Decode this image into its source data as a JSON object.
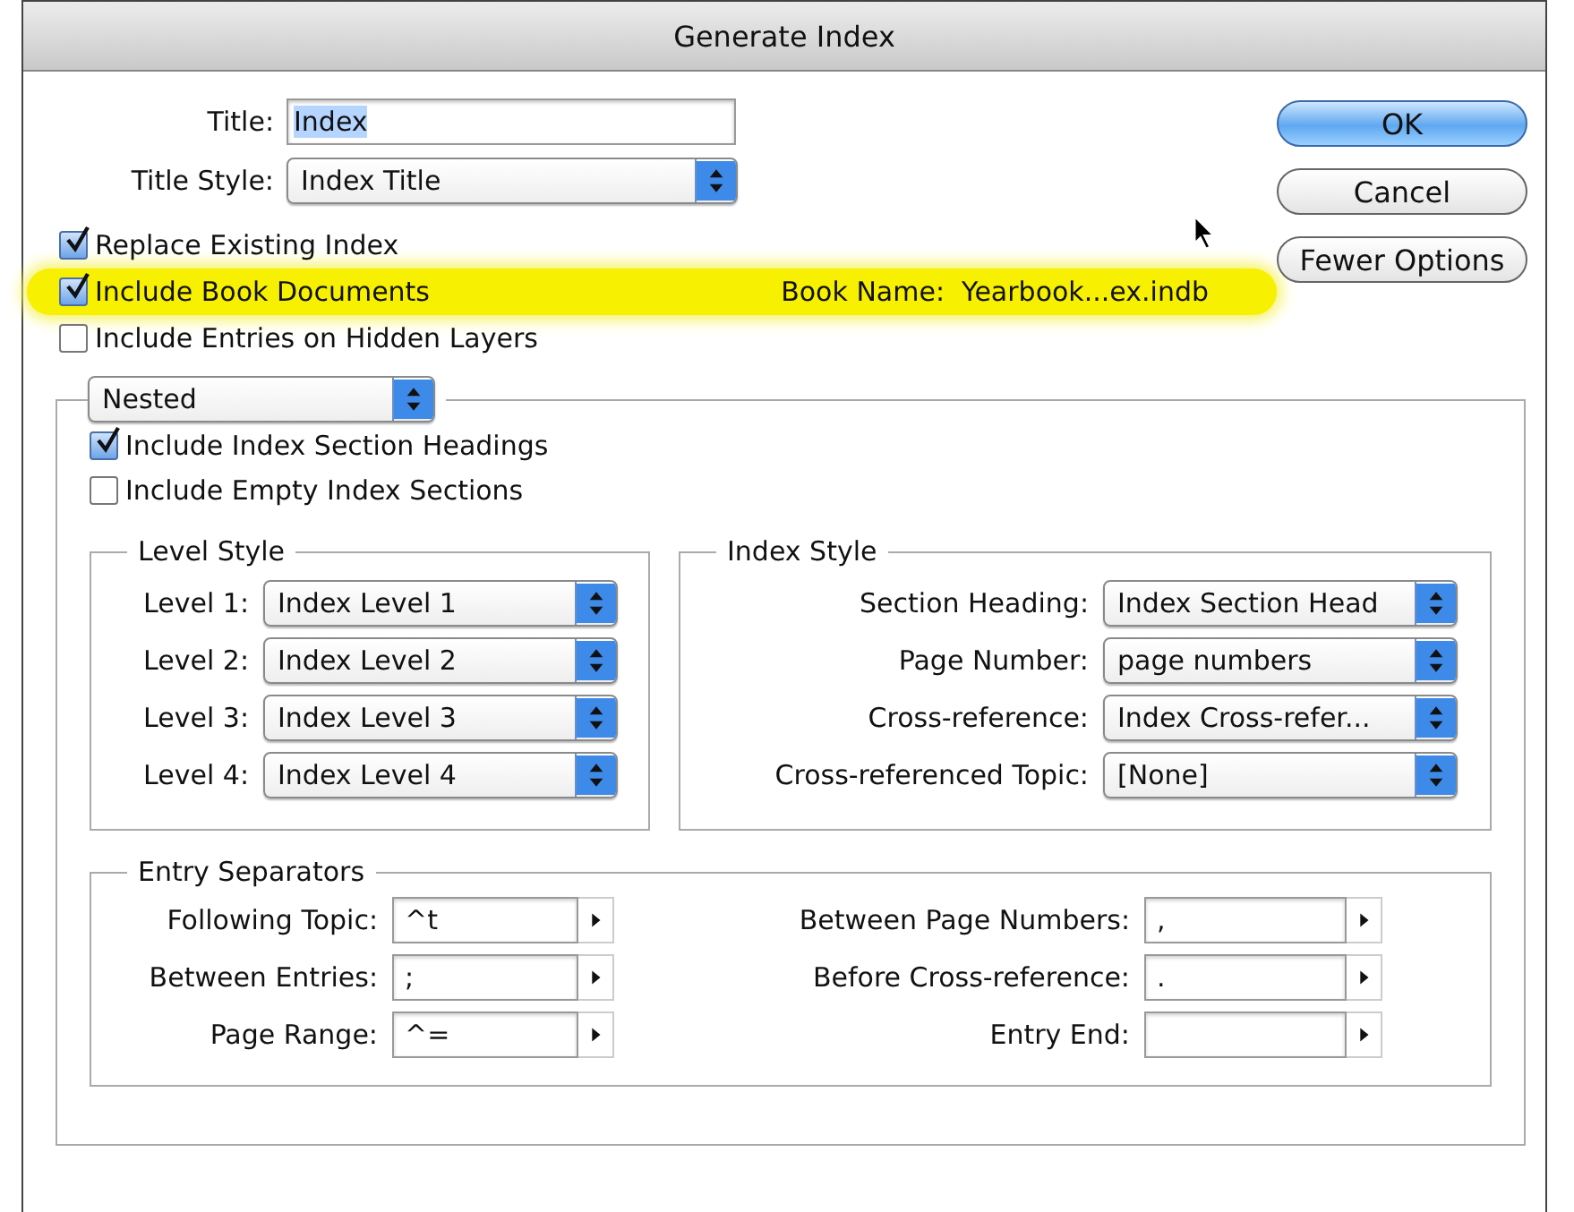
{
  "window": {
    "title": "Generate Index"
  },
  "title_field": {
    "label": "Title:",
    "value": "Index",
    "selected": true
  },
  "title_style": {
    "label": "Title Style:",
    "value": "Index Title"
  },
  "buttons": [
    {
      "label": "OK",
      "default": true
    },
    {
      "label": "Cancel",
      "default": false
    },
    {
      "label": "Fewer Options",
      "default": false
    }
  ],
  "options": [
    {
      "label": "Replace Existing Index",
      "checked": true,
      "highlighted": false
    },
    {
      "label": "Include Book Documents",
      "checked": true,
      "highlighted": true,
      "note": "Book Name:  Yearbook...ex.indb"
    },
    {
      "label": "Include Entries on Hidden Layers",
      "checked": false,
      "highlighted": false
    }
  ],
  "mode": {
    "value": "Nested"
  },
  "section_options": [
    {
      "label": "Include Index Section Headings",
      "checked": true
    },
    {
      "label": "Include Empty Index Sections",
      "checked": false
    }
  ],
  "level_style": {
    "title": "Level Style",
    "rows": [
      {
        "label": "Level 1:",
        "value": "Index Level 1"
      },
      {
        "label": "Level 2:",
        "value": "Index Level 2"
      },
      {
        "label": "Level 3:",
        "value": "Index Level 3"
      },
      {
        "label": "Level 4:",
        "value": "Index Level 4"
      }
    ]
  },
  "index_style": {
    "title": "Index Style",
    "rows": [
      {
        "label": "Section Heading:",
        "value": "Index Section Head"
      },
      {
        "label": "Page Number:",
        "value": "page numbers"
      },
      {
        "label": "Cross-reference:",
        "value": "Index Cross-refer..."
      },
      {
        "label": "Cross-referenced Topic:",
        "value": "[None]"
      }
    ]
  },
  "entry_separators": {
    "title": "Entry Separators",
    "left": [
      {
        "label": "Following Topic:",
        "value": "^t"
      },
      {
        "label": "Between Entries:",
        "value": ";"
      },
      {
        "label": "Page Range:",
        "value": "^="
      }
    ],
    "right": [
      {
        "label": "Between Page Numbers:",
        "value": ","
      },
      {
        "label": "Before Cross-reference:",
        "value": "."
      },
      {
        "label": "Entry End:"
      }
    ]
  }
}
